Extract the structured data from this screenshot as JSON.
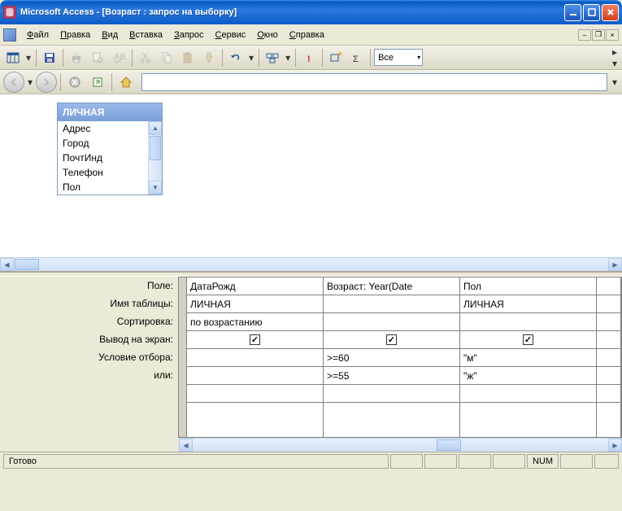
{
  "window": {
    "title": "Microsoft Access - [Возраст : запрос на выборку]"
  },
  "menus": {
    "file": "Файл",
    "edit": "Правка",
    "view": "Вид",
    "insert": "Вставка",
    "query": "Запрос",
    "service": "Сервис",
    "window": "Окно",
    "help": "Справка"
  },
  "toolbar": {
    "combo_value": "Все"
  },
  "table": {
    "name": "ЛИЧНАЯ",
    "fields": [
      "Адрес",
      "Город",
      "ПочтИнд",
      "Телефон",
      "Пол"
    ]
  },
  "grid": {
    "row_labels": {
      "field": "Поле:",
      "table": "Имя таблицы:",
      "sort": "Сортировка:",
      "show": "Вывод на экран:",
      "criteria": "Условие отбора:",
      "or": "или:"
    },
    "columns": [
      {
        "field": "ДатаРожд",
        "table": "ЛИЧНАЯ",
        "sort": "по возрастанию",
        "show": true,
        "criteria": "",
        "or": ""
      },
      {
        "field": "Возраст: Year(Date",
        "table": "",
        "sort": "",
        "show": true,
        "criteria": ">=60",
        "or": ">=55"
      },
      {
        "field": "Пол",
        "table": "ЛИЧНАЯ",
        "sort": "",
        "show": true,
        "criteria": "\"м\"",
        "or": "\"ж\""
      }
    ]
  },
  "status": {
    "ready": "Готово",
    "num": "NUM"
  }
}
